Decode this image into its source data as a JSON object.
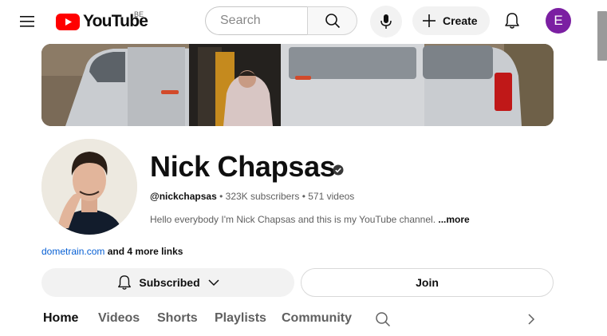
{
  "header": {
    "logo_text": "YouTube",
    "country_code": "BE",
    "search_placeholder": "Search",
    "create_label": "Create",
    "account_initial": "E"
  },
  "channel": {
    "name": "Nick Chapsas",
    "handle": "@nickchapsas",
    "subscribers": "323K subscribers",
    "videos": "571 videos",
    "meta_separator": "•",
    "description": "Hello everybody I'm Nick Chapsas and this is my YouTube channel.",
    "description_more": "...more",
    "link_text": "dometrain.com",
    "more_links": "and 4 more links"
  },
  "actions": {
    "subscribed_label": "Subscribed",
    "join_label": "Join"
  },
  "tabs": [
    "Home",
    "Videos",
    "Shorts",
    "Playlists",
    "Community"
  ],
  "colors": {
    "brand_red": "#ff0000",
    "avatar_purple": "#7b1fa2",
    "link_blue": "#065fd4"
  }
}
